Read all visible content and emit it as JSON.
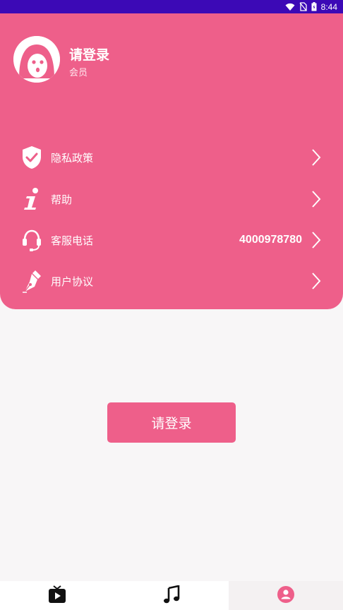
{
  "status_bar": {
    "time": "8:44",
    "icons": [
      "wifi-icon",
      "no-sim-icon",
      "battery-icon"
    ]
  },
  "profile": {
    "name": "请登录",
    "level": "会员",
    "avatar_icon": "ghost-avatar-icon"
  },
  "menu": [
    {
      "icon": "shield-check-icon",
      "label": "隐私政策",
      "value": ""
    },
    {
      "icon": "info-icon",
      "label": "帮助",
      "value": ""
    },
    {
      "icon": "headset-icon",
      "label": "客服电话",
      "value": "4000978780"
    },
    {
      "icon": "pen-nib-icon",
      "label": "用户协议",
      "value": ""
    }
  ],
  "login_button": {
    "label": "请登录"
  },
  "bottom_nav": [
    {
      "icon": "tv-play-icon",
      "active": false
    },
    {
      "icon": "music-note-icon",
      "active": false
    },
    {
      "icon": "profile-icon",
      "active": true
    }
  ],
  "colors": {
    "accent": "#ee5f8a",
    "status_bar": "#3c09b6",
    "background": "#f8f6f7"
  }
}
